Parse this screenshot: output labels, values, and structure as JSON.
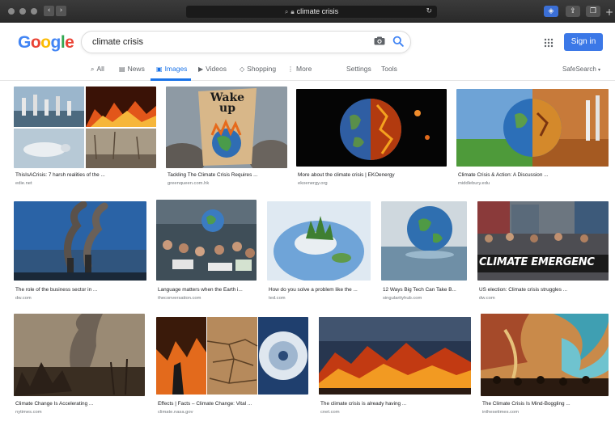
{
  "browser": {
    "url": "climate crisis",
    "back": "‹",
    "forward": "›"
  },
  "logo_text": "Google",
  "search": {
    "query": "climate crisis"
  },
  "header": {
    "sign_in_label": "Sign in"
  },
  "tabs": [
    {
      "label": "All",
      "icon": "search-icon"
    },
    {
      "label": "News",
      "icon": "news-icon"
    },
    {
      "label": "Images",
      "icon": "images-icon"
    },
    {
      "label": "Videos",
      "icon": "video-icon"
    },
    {
      "label": "Shopping",
      "icon": "tag-icon"
    },
    {
      "label": "More",
      "icon": "more-vertical-icon"
    },
    {
      "label": "Settings"
    },
    {
      "label": "Tools"
    }
  ],
  "safesearch_label": "SafeSearch",
  "colors": {
    "accent": "#1a73e8",
    "sign_in_button": "#3b78e7"
  },
  "results": [
    {
      "title": "ThisIsACrisis: 7 harsh realities of the ...",
      "source": "edie.net"
    },
    {
      "title": "Tackling The Climate Crisis Requires ...",
      "source": "greenqueen.com.hk",
      "sign_text": [
        "Wake",
        "up"
      ]
    },
    {
      "title": "More about the climate crisis | EKOenergy",
      "source": "ekoenergy.org"
    },
    {
      "title": "Climate Crisis & Action: A Discussion ...",
      "source": "middlebury.edu"
    },
    {
      "title": "The role of the business sector in ...",
      "source": "dw.com"
    },
    {
      "title": "Language matters when the Earth i...",
      "source": "theconversation.com"
    },
    {
      "title": "How do you solve a problem like the ...",
      "source": "ted.com"
    },
    {
      "title": "12 Ways Big Tech Can Take B...",
      "source": "singularityhub.com"
    },
    {
      "title": "US election: Climate crisis struggles ...",
      "source": "dw.com",
      "banner_text": "CLIMATE EMERGENC"
    },
    {
      "title": "Climate Change Is Accelerating ...",
      "source": "nytimes.com"
    },
    {
      "title": "Effects | Facts – Climate Change: Vital ...",
      "source": "climate.nasa.gov"
    },
    {
      "title": "The climate crisis is already having ...",
      "source": "cnet.com"
    },
    {
      "title": "The Climate Crisis Is Mind-Boggling ...",
      "source": "inthesetimes.com"
    }
  ]
}
